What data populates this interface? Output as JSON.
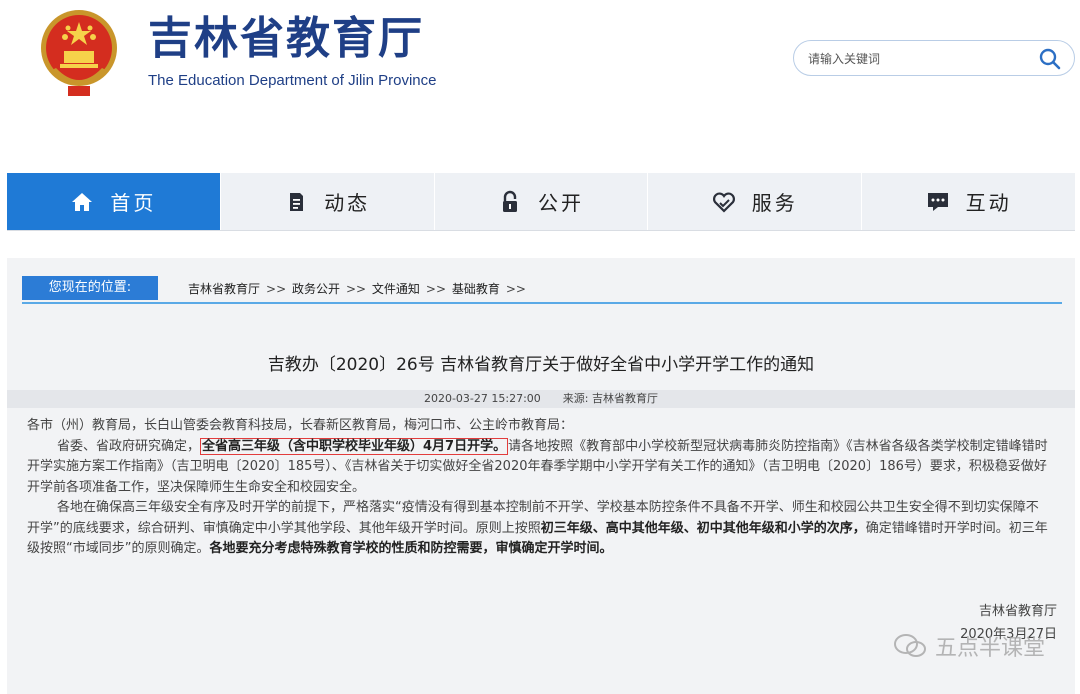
{
  "header": {
    "title": "吉林省教育厅",
    "subtitle": "The Education Department of Jilin Province",
    "search_placeholder": "请输入关键词"
  },
  "nav": {
    "items": [
      {
        "label": "首页",
        "icon": "home-icon",
        "active": true
      },
      {
        "label": "动态",
        "icon": "document-icon"
      },
      {
        "label": "公开",
        "icon": "lock-icon"
      },
      {
        "label": "服务",
        "icon": "heart-hand-icon"
      },
      {
        "label": "互动",
        "icon": "chat-icon"
      }
    ]
  },
  "breadcrumb": {
    "label": "您现在的位置:",
    "items": [
      "吉林省教育厅",
      "政务公开",
      "文件通知",
      "基础教育"
    ],
    "separator": ">>"
  },
  "article": {
    "title": "吉教办〔2020〕26号 吉林省教育厅关于做好全省中小学开学工作的通知",
    "date": "2020-03-27 15:27:00",
    "source_label": "来源:",
    "source": "吉林省教育厅",
    "salutation": "各市（州）教育局，长白山管委会教育科技局，长春新区教育局，梅河口市、公主岭市教育局：",
    "p1_a": "省委、省政府研究确定，",
    "p1_highlight": "全省高三年级（含中职学校毕业年级）4月7日开学。",
    "p1_b": "请各地按照《教育部中小学校新型冠状病毒肺炎防控指南》《吉林省各级各类学校制定错峰错时开学实施方案工作指南》（吉卫明电〔2020〕185号）、《吉林省关于切实做好全省2020年春季学期中小学开学有关工作的通知》（吉卫明电〔2020〕186号）要求，积极稳妥做好开学前各项准备工作，坚决保障师生生命安全和校园安全。",
    "p2_a": "各地在确保高三年级安全有序及时开学的前提下，严格落实“疫情没有得到基本控制前不开学、学校基本防控条件不具备不开学、师生和校园公共卫生安全得不到切实保障不开学”的底线要求，综合研判、审慎确定中小学其他学段、其他年级开学时间。原则上按照",
    "p2_bold": "初三年级、高中其他年级、初中其他年级和小学的次序，",
    "p2_b": "确定错峰错时开学时间。初三年级按照“市域同步”的原则确定。",
    "p2_bold2": "各地要充分考虑特殊教育学校的性质和防控需要，审慎确定开学时间。",
    "sign_org": "吉林省教育厅",
    "sign_date": "2020年3月27日"
  },
  "watermark": "五点半课堂",
  "colors": {
    "brand_blue": "#1f3f86",
    "nav_active": "#1f7ad6",
    "highlight_border": "#e23c3c"
  }
}
